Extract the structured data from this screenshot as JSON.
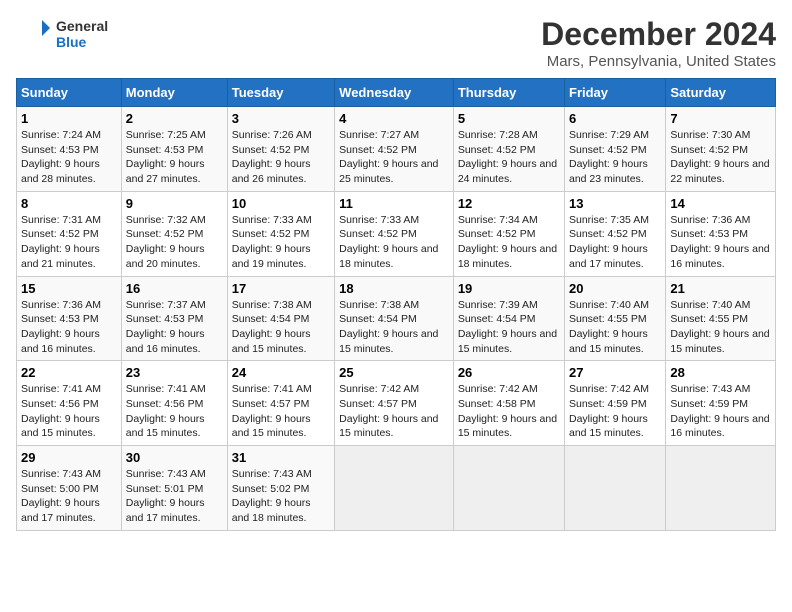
{
  "logo": {
    "line1": "General",
    "line2": "Blue"
  },
  "title": "December 2024",
  "subtitle": "Mars, Pennsylvania, United States",
  "days_header": [
    "Sunday",
    "Monday",
    "Tuesday",
    "Wednesday",
    "Thursday",
    "Friday",
    "Saturday"
  ],
  "weeks": [
    [
      {
        "day": "1",
        "sunrise": "7:24 AM",
        "sunset": "4:53 PM",
        "daylight": "9 hours and 28 minutes."
      },
      {
        "day": "2",
        "sunrise": "7:25 AM",
        "sunset": "4:53 PM",
        "daylight": "9 hours and 27 minutes."
      },
      {
        "day": "3",
        "sunrise": "7:26 AM",
        "sunset": "4:52 PM",
        "daylight": "9 hours and 26 minutes."
      },
      {
        "day": "4",
        "sunrise": "7:27 AM",
        "sunset": "4:52 PM",
        "daylight": "9 hours and 25 minutes."
      },
      {
        "day": "5",
        "sunrise": "7:28 AM",
        "sunset": "4:52 PM",
        "daylight": "9 hours and 24 minutes."
      },
      {
        "day": "6",
        "sunrise": "7:29 AM",
        "sunset": "4:52 PM",
        "daylight": "9 hours and 23 minutes."
      },
      {
        "day": "7",
        "sunrise": "7:30 AM",
        "sunset": "4:52 PM",
        "daylight": "9 hours and 22 minutes."
      }
    ],
    [
      {
        "day": "8",
        "sunrise": "7:31 AM",
        "sunset": "4:52 PM",
        "daylight": "9 hours and 21 minutes."
      },
      {
        "day": "9",
        "sunrise": "7:32 AM",
        "sunset": "4:52 PM",
        "daylight": "9 hours and 20 minutes."
      },
      {
        "day": "10",
        "sunrise": "7:33 AM",
        "sunset": "4:52 PM",
        "daylight": "9 hours and 19 minutes."
      },
      {
        "day": "11",
        "sunrise": "7:33 AM",
        "sunset": "4:52 PM",
        "daylight": "9 hours and 18 minutes."
      },
      {
        "day": "12",
        "sunrise": "7:34 AM",
        "sunset": "4:52 PM",
        "daylight": "9 hours and 18 minutes."
      },
      {
        "day": "13",
        "sunrise": "7:35 AM",
        "sunset": "4:52 PM",
        "daylight": "9 hours and 17 minutes."
      },
      {
        "day": "14",
        "sunrise": "7:36 AM",
        "sunset": "4:53 PM",
        "daylight": "9 hours and 16 minutes."
      }
    ],
    [
      {
        "day": "15",
        "sunrise": "7:36 AM",
        "sunset": "4:53 PM",
        "daylight": "9 hours and 16 minutes."
      },
      {
        "day": "16",
        "sunrise": "7:37 AM",
        "sunset": "4:53 PM",
        "daylight": "9 hours and 16 minutes."
      },
      {
        "day": "17",
        "sunrise": "7:38 AM",
        "sunset": "4:54 PM",
        "daylight": "9 hours and 15 minutes."
      },
      {
        "day": "18",
        "sunrise": "7:38 AM",
        "sunset": "4:54 PM",
        "daylight": "9 hours and 15 minutes."
      },
      {
        "day": "19",
        "sunrise": "7:39 AM",
        "sunset": "4:54 PM",
        "daylight": "9 hours and 15 minutes."
      },
      {
        "day": "20",
        "sunrise": "7:40 AM",
        "sunset": "4:55 PM",
        "daylight": "9 hours and 15 minutes."
      },
      {
        "day": "21",
        "sunrise": "7:40 AM",
        "sunset": "4:55 PM",
        "daylight": "9 hours and 15 minutes."
      }
    ],
    [
      {
        "day": "22",
        "sunrise": "7:41 AM",
        "sunset": "4:56 PM",
        "daylight": "9 hours and 15 minutes."
      },
      {
        "day": "23",
        "sunrise": "7:41 AM",
        "sunset": "4:56 PM",
        "daylight": "9 hours and 15 minutes."
      },
      {
        "day": "24",
        "sunrise": "7:41 AM",
        "sunset": "4:57 PM",
        "daylight": "9 hours and 15 minutes."
      },
      {
        "day": "25",
        "sunrise": "7:42 AM",
        "sunset": "4:57 PM",
        "daylight": "9 hours and 15 minutes."
      },
      {
        "day": "26",
        "sunrise": "7:42 AM",
        "sunset": "4:58 PM",
        "daylight": "9 hours and 15 minutes."
      },
      {
        "day": "27",
        "sunrise": "7:42 AM",
        "sunset": "4:59 PM",
        "daylight": "9 hours and 15 minutes."
      },
      {
        "day": "28",
        "sunrise": "7:43 AM",
        "sunset": "4:59 PM",
        "daylight": "9 hours and 16 minutes."
      }
    ],
    [
      {
        "day": "29",
        "sunrise": "7:43 AM",
        "sunset": "5:00 PM",
        "daylight": "9 hours and 17 minutes."
      },
      {
        "day": "30",
        "sunrise": "7:43 AM",
        "sunset": "5:01 PM",
        "daylight": "9 hours and 17 minutes."
      },
      {
        "day": "31",
        "sunrise": "7:43 AM",
        "sunset": "5:02 PM",
        "daylight": "9 hours and 18 minutes."
      },
      null,
      null,
      null,
      null
    ]
  ]
}
